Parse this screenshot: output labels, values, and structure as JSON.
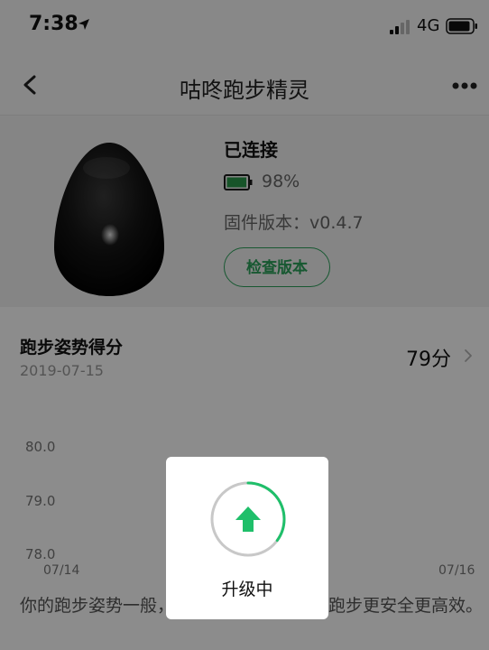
{
  "status_bar": {
    "time": "7:38",
    "network": "4G"
  },
  "nav": {
    "title": "咕咚跑步精灵"
  },
  "device": {
    "status": "已连接",
    "battery": "98%",
    "battery_level": 0.98,
    "firmware": "固件版本：v0.4.7",
    "check_button": "检查版本"
  },
  "score": {
    "title": "跑步姿势得分",
    "date": "2019-07-15",
    "value": "79分"
  },
  "chart": {
    "y_ticks": [
      "80.0",
      "79.0",
      "78.0"
    ],
    "x_ticks": [
      "07/14",
      "07/16"
    ]
  },
  "description": "你的跑步姿势一般，调整姿势可以让你的跑步更安全更高效。",
  "modal": {
    "label": "升级中",
    "progress": 0.35
  },
  "colors": {
    "accent": "#2aa15a",
    "battery_fill": "#2b9a4c",
    "progress": "#1fbf6a"
  }
}
